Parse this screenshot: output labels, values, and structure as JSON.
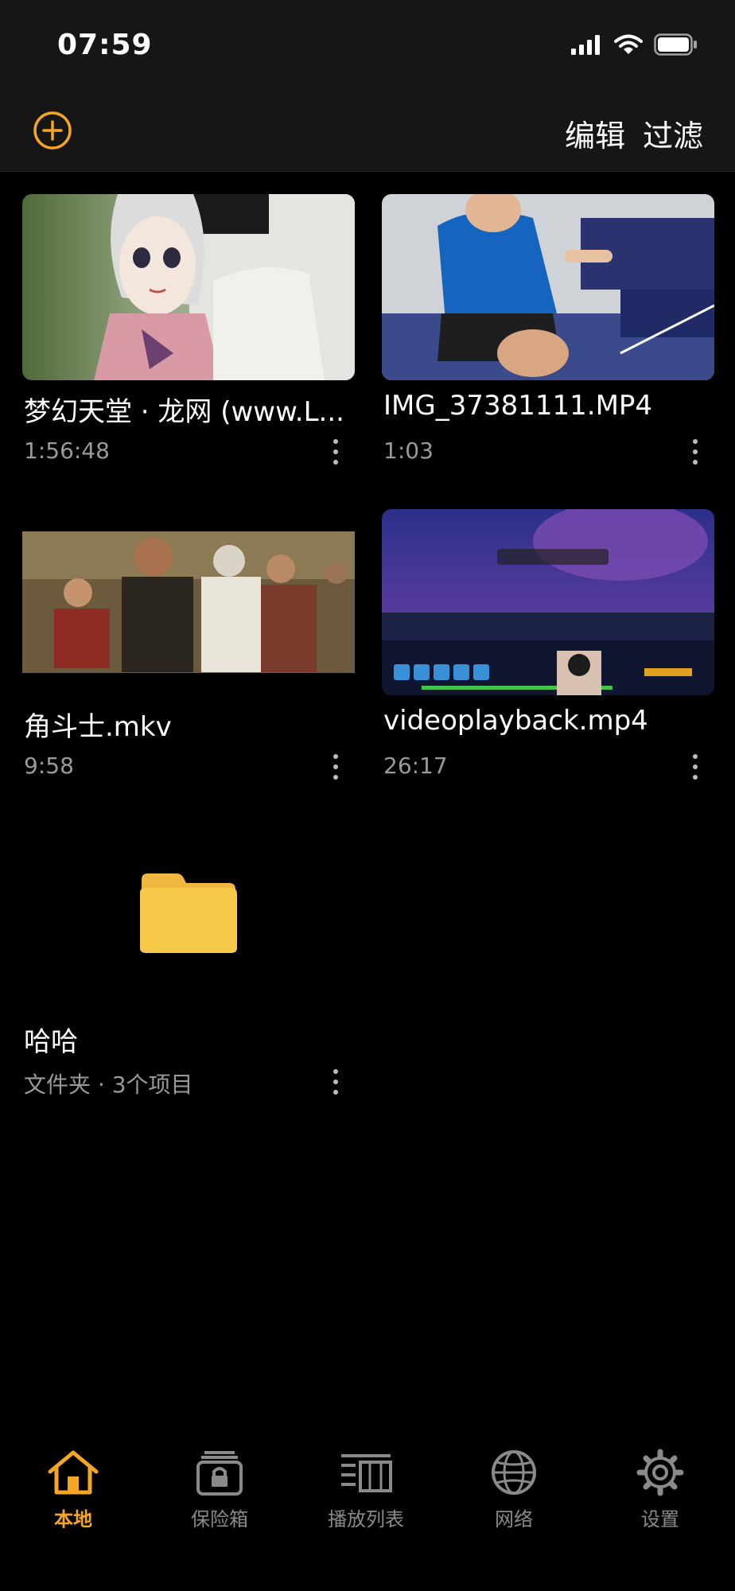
{
  "status": {
    "time": "07:59"
  },
  "header": {
    "edit_label": "编辑",
    "filter_label": "过滤"
  },
  "videos": [
    {
      "title": "梦幻天堂 · 龙网 (www.L...",
      "duration": "1:56:48",
      "thumb": "anime"
    },
    {
      "title": "IMG_37381111.MP4",
      "duration": "1:03",
      "thumb": "pingpong"
    },
    {
      "title": "角斗士.mkv",
      "duration": "9:58",
      "thumb": "crowd"
    },
    {
      "title": "videoplayback.mp4",
      "duration": "26:17",
      "thumb": "game"
    }
  ],
  "folder": {
    "name": "哈哈",
    "meta": "文件夹 · 3个项目"
  },
  "tabs": [
    {
      "label": "本地",
      "icon": "home-icon",
      "active": true
    },
    {
      "label": "保险箱",
      "icon": "safe-icon",
      "active": false
    },
    {
      "label": "播放列表",
      "icon": "playlist-icon",
      "active": false
    },
    {
      "label": "网络",
      "icon": "globe-icon",
      "active": false
    },
    {
      "label": "设置",
      "icon": "gear-icon",
      "active": false
    }
  ],
  "colors": {
    "accent": "#f5a623",
    "folder": "#f7c948",
    "inactive": "#8a8a8a"
  }
}
